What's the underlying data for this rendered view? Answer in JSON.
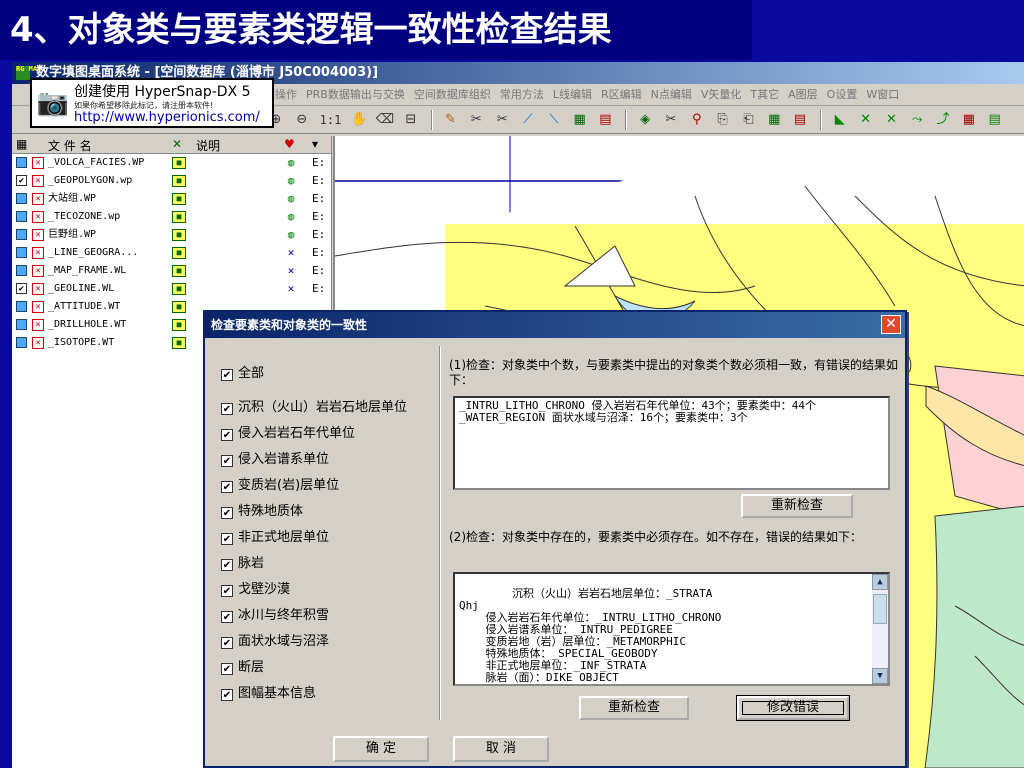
{
  "slide": {
    "title": "4、对象类与要素类逻辑一致性检查结果"
  },
  "app": {
    "title": "数字填图桌面系统 - [空间数据库   (淄博市   J50C004003)]",
    "menus": [
      "据操作",
      "PRB数据输出与交换",
      "空间数据库组织",
      "常用方法",
      "L线编辑",
      "R区编辑",
      "N点编辑",
      "V矢量化",
      "T其它",
      "A图层",
      "O设置",
      "W窗口"
    ],
    "zoom_label": "1:1"
  },
  "hypersnap": {
    "line1": "创建使用 HyperSnap-DX 5",
    "line2": "如果你希望移除此标记，请注册本软件!",
    "line3": "http://www.hyperionics.com/"
  },
  "layers": {
    "headers": {
      "file": "文 件 名",
      "desc": "说明"
    },
    "rows": [
      {
        "name": "_VOLCA_FACIES.WP",
        "checked": false,
        "drive": "E:"
      },
      {
        "name": "_GEOPOLYGON.wp",
        "checked": true,
        "drive": "E:"
      },
      {
        "name": "大站组.WP",
        "checked": false,
        "drive": "E:"
      },
      {
        "name": "_TECOZONE.wp",
        "checked": false,
        "drive": "E:"
      },
      {
        "name": "巨野组.WP",
        "checked": false,
        "drive": "E:"
      },
      {
        "name": "_LINE_GEOGRA...",
        "checked": false,
        "drive": "E:"
      },
      {
        "name": "_MAP_FRAME.WL",
        "checked": false,
        "drive": "E:"
      },
      {
        "name": "_GEOLINE.WL",
        "checked": true,
        "drive": "E:"
      },
      {
        "name": "_ATTITUDE.WT",
        "checked": false,
        "drive": ""
      },
      {
        "name": "_DRILLHOLE.WT",
        "checked": false,
        "drive": ""
      },
      {
        "name": "_ISOTOPE.WT",
        "checked": false,
        "drive": ""
      }
    ]
  },
  "dialog": {
    "title": "检查要素类和对象类的一致性",
    "checkboxes": [
      {
        "label": "全部",
        "checked": true
      },
      {
        "label": "沉积（火山）岩岩石地层单位",
        "checked": true
      },
      {
        "label": "侵入岩岩石年代单位",
        "checked": true
      },
      {
        "label": "侵入岩谱系单位",
        "checked": true
      },
      {
        "label": "变质岩(岩)层单位",
        "checked": true
      },
      {
        "label": "特殊地质体",
        "checked": true
      },
      {
        "label": "非正式地层单位",
        "checked": true
      },
      {
        "label": "脉岩",
        "checked": true
      },
      {
        "label": "戈壁沙漠",
        "checked": true
      },
      {
        "label": "冰川与终年积雪",
        "checked": true
      },
      {
        "label": "面状水域与沼泽",
        "checked": true
      },
      {
        "label": "断层",
        "checked": true
      },
      {
        "label": "图幅基本信息",
        "checked": true
      }
    ],
    "check1_desc": "(1)检查：对象类中个数，与要素类中提出的对象类个数必须相一致，有错误的结果如下：",
    "check1_result": "_INTRU_LITHO_CHRONO 侵入岩岩石年代单位：43个；要素类中：44个\n_WATER_REGION 面状水域与沼泽：16个；要素类中：3个",
    "recheck_label": "重新检查",
    "check2_desc": "(2)检查：对象类中存在的，要素类中必须存在。如不存在，错误的结果如下：",
    "check2_result": "    沉积（火山）岩岩石地层单位：_STRATA\nQhj\n    侵入岩岩石年代单位：_INTRU_LITHO_CHRONO\n    侵入岩谱系单位：_INTRU_PEDIGREE\n    变质岩地（岩）层单位：_METAMORPHIC\n    特殊地质体：_SPECIAL_GEOBODY\n    非正式地层单位：_INF_STRATA\n    脉岩（面）：DIKE OBJECT",
    "recheck2_label": "重新检查",
    "fix_label": "修改错误",
    "ok_label": "确  定",
    "cancel_label": "取  消"
  }
}
